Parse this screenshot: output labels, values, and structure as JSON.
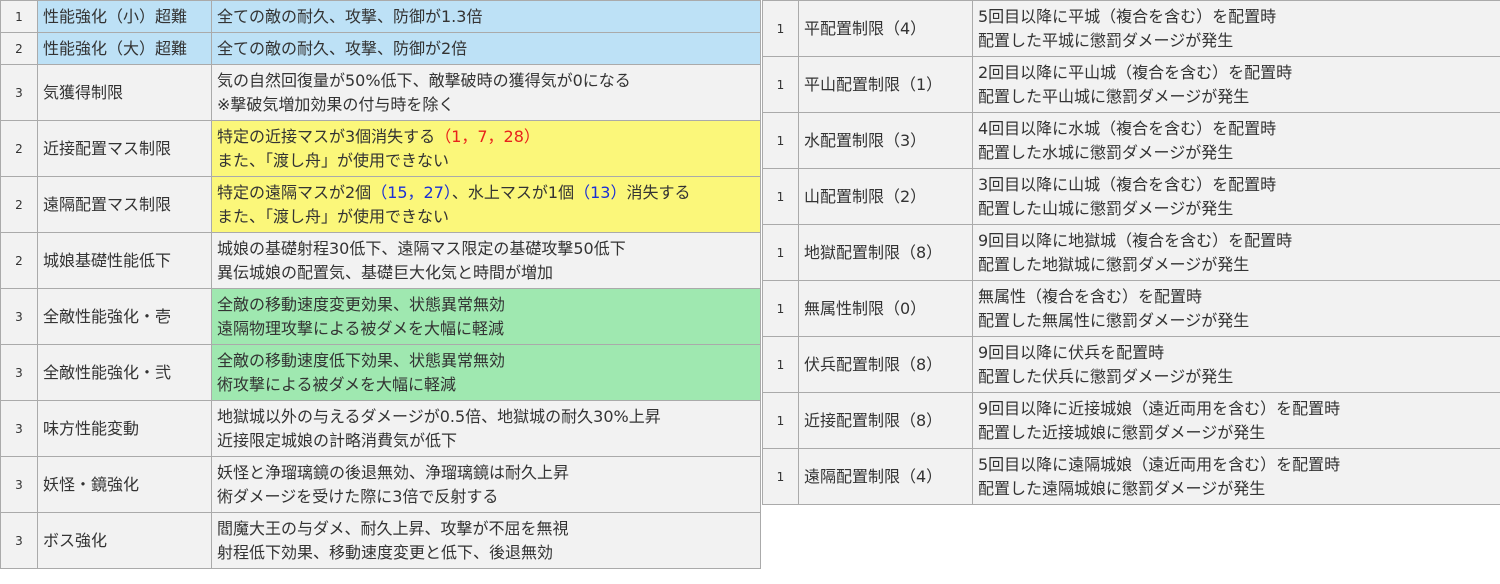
{
  "colors": {
    "blue": "#bde1f6",
    "yellow": "#fbf77a",
    "green": "#9fe8b0",
    "gray": "#f2f2f2",
    "red_text": "#e8221b",
    "blue_text": "#1a2fd6"
  },
  "left": {
    "rows": [
      {
        "num": "1",
        "name": "性能強化（小）超難",
        "bg": "blue",
        "line1": "全ての敵の耐久、攻撃、防御が1.3倍",
        "line2": ""
      },
      {
        "num": "2",
        "name": "性能強化（大）超難",
        "bg": "blue",
        "line1": "全ての敵の耐久、攻撃、防御が2倍",
        "line2": ""
      },
      {
        "num": "3",
        "name": "気獲得制限",
        "bg": "gray",
        "line1": "気の自然回復量が50%低下、敵撃破時の獲得気が0になる",
        "line2": "※撃破気増加効果の付与時を除く"
      },
      {
        "num": "2",
        "name": "近接配置マス制限",
        "bg": "yellow",
        "line1_a": "特定の近接マスが3個消失する",
        "line1_b": "（1，7，28）",
        "line2": "また、「渡し舟」が使用できない"
      },
      {
        "num": "2",
        "name": "遠隔配置マス制限",
        "bg": "yellow",
        "line1_a": "特定の遠隔マスが2個",
        "line1_b": "（15，27）",
        "line1_c": "、水上マスが1個",
        "line1_d": "（13）",
        "line1_e": "消失する",
        "line2": "また、「渡し舟」が使用できない"
      },
      {
        "num": "2",
        "name": "城娘基礎性能低下",
        "bg": "gray",
        "line1": "城娘の基礎射程30低下、遠隔マス限定の基礎攻撃50低下",
        "line2": "異伝城娘の配置気、基礎巨大化気と時間が増加"
      },
      {
        "num": "3",
        "name": "全敵性能強化・壱",
        "bg": "green",
        "line1": "全敵の移動速度変更効果、状態異常無効",
        "line2": "遠隔物理攻撃による被ダメを大幅に軽減"
      },
      {
        "num": "3",
        "name": "全敵性能強化・弐",
        "bg": "green",
        "line1": "全敵の移動速度低下効果、状態異常無効",
        "line2": "術攻撃による被ダメを大幅に軽減"
      },
      {
        "num": "3",
        "name": "味方性能変動",
        "bg": "gray",
        "line1": "地獄城以外の与えるダメージが0.5倍、地獄城の耐久30%上昇",
        "line2": "近接限定城娘の計略消費気が低下"
      },
      {
        "num": "3",
        "name": "妖怪・鏡強化",
        "bg": "gray",
        "line1": "妖怪と浄瑠璃鏡の後退無効、浄瑠璃鏡は耐久上昇",
        "line2": "術ダメージを受けた際に3倍で反射する"
      },
      {
        "num": "3",
        "name": "ボス強化",
        "bg": "gray",
        "line1": "閻魔大王の与ダメ、耐久上昇、攻撃が不屈を無視",
        "line2": "射程低下効果、移動速度変更と低下、後退無効"
      }
    ]
  },
  "right": {
    "rows": [
      {
        "num": "1",
        "name": "平配置制限（4）",
        "line1": "5回目以降に平城（複合を含む）を配置時",
        "line2": "配置した平城に懲罰ダメージが発生"
      },
      {
        "num": "1",
        "name": "平山配置制限（1）",
        "line1": "2回目以降に平山城（複合を含む）を配置時",
        "line2": "配置した平山城に懲罰ダメージが発生"
      },
      {
        "num": "1",
        "name": "水配置制限（3）",
        "line1": "4回目以降に水城（複合を含む）を配置時",
        "line2": "配置した水城に懲罰ダメージが発生"
      },
      {
        "num": "1",
        "name": "山配置制限（2）",
        "line1": "3回目以降に山城（複合を含む）を配置時",
        "line2": "配置した山城に懲罰ダメージが発生"
      },
      {
        "num": "1",
        "name": "地獄配置制限（8）",
        "line1": "9回目以降に地獄城（複合を含む）を配置時",
        "line2": "配置した地獄城に懲罰ダメージが発生"
      },
      {
        "num": "1",
        "name": "無属性制限（0）",
        "line1": "無属性（複合を含む）を配置時",
        "line2": "配置した無属性に懲罰ダメージが発生"
      },
      {
        "num": "1",
        "name": "伏兵配置制限（8）",
        "line1": "9回目以降に伏兵を配置時",
        "line2": "配置した伏兵に懲罰ダメージが発生"
      },
      {
        "num": "1",
        "name": "近接配置制限（8）",
        "line1": "9回目以降に近接城娘（遠近両用を含む）を配置時",
        "line2": "配置した近接城娘に懲罰ダメージが発生"
      },
      {
        "num": "1",
        "name": "遠隔配置制限（4）",
        "line1": "5回目以降に遠隔城娘（遠近両用を含む）を配置時",
        "line2": "配置した遠隔城娘に懲罰ダメージが発生"
      }
    ]
  }
}
